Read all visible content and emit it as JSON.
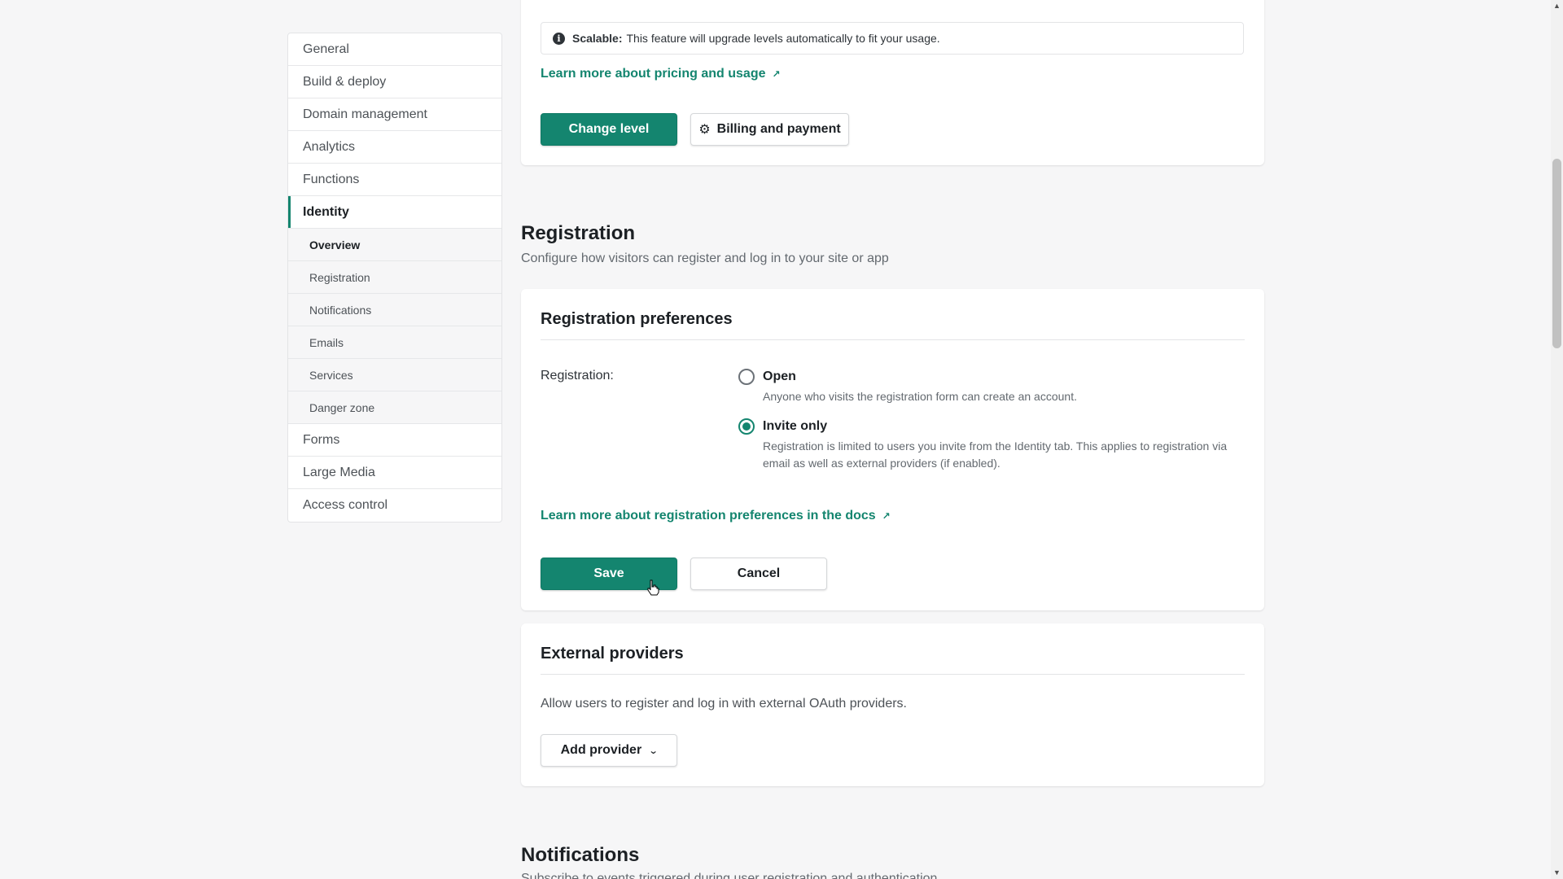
{
  "sidebar": {
    "items": [
      {
        "label": "General"
      },
      {
        "label": "Build & deploy"
      },
      {
        "label": "Domain management"
      },
      {
        "label": "Analytics"
      },
      {
        "label": "Functions"
      },
      {
        "label": "Identity"
      },
      {
        "label": "Forms"
      },
      {
        "label": "Large Media"
      },
      {
        "label": "Access control"
      }
    ],
    "identity_subitems": [
      {
        "label": "Overview"
      },
      {
        "label": "Registration"
      },
      {
        "label": "Notifications"
      },
      {
        "label": "Emails"
      },
      {
        "label": "Services"
      },
      {
        "label": "Danger zone"
      }
    ]
  },
  "level_card": {
    "info_bold": "Scalable:",
    "info_text": "This feature will upgrade levels automatically to fit your usage.",
    "pricing_link": "Learn more about pricing and usage",
    "change_level_button": "Change level",
    "billing_button": "Billing and payment"
  },
  "registration": {
    "title": "Registration",
    "description": "Configure how visitors can register and log in to your site or app",
    "card_title": "Registration preferences",
    "field_label": "Registration:",
    "options": [
      {
        "label": "Open",
        "help": "Anyone who visits the registration form can create an account.",
        "checked": false
      },
      {
        "label": "Invite only",
        "help": "Registration is limited to users you invite from the Identity tab. This applies to registration via email as well as external providers (if enabled).",
        "checked": true
      }
    ],
    "docs_link": "Learn more about registration preferences in the docs",
    "save_button": "Save",
    "cancel_button": "Cancel"
  },
  "external_providers": {
    "title": "External providers",
    "description": "Allow users to register and log in with external OAuth providers.",
    "add_button": "Add provider"
  },
  "notifications": {
    "title": "Notifications",
    "description": "Subscribe to events triggered during user registration and authentication"
  },
  "colors": {
    "accent": "#14856f",
    "page_bg": "#f6f6f7"
  }
}
